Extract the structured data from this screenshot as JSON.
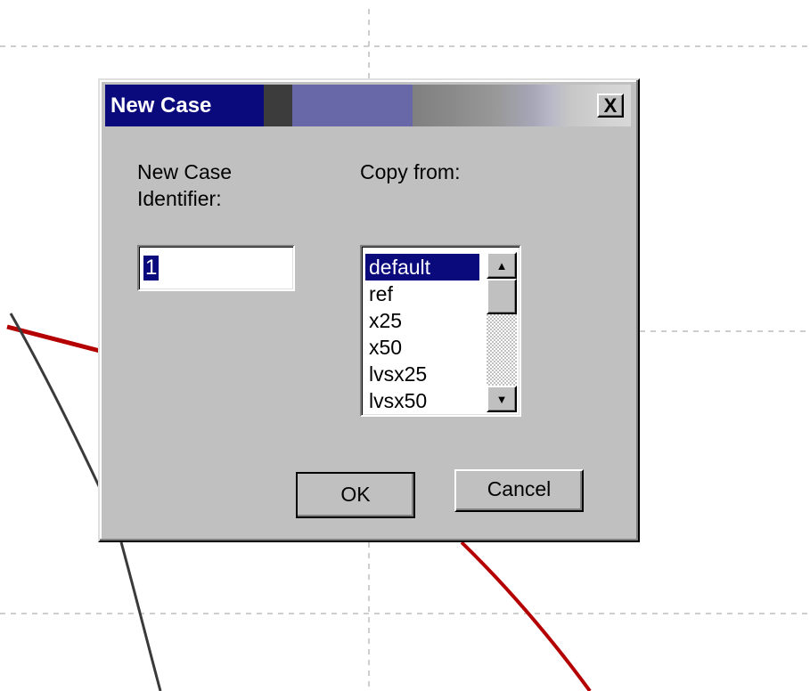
{
  "dialog": {
    "title": "New Case",
    "close_label": "X",
    "identifier_label_line1": "New Case",
    "identifier_label_line2": "Identifier:",
    "identifier_value": "1",
    "copy_from_label": "Copy from:",
    "copy_from_options": [
      "default",
      "ref",
      "x25",
      "x50",
      "lvsx25",
      "lvsx50"
    ],
    "copy_from_selected": "default",
    "ok_label": "OK",
    "cancel_label": "Cancel"
  },
  "colors": {
    "title_bar_active": "#0a0a7c",
    "dialog_face": "#c0c0c0",
    "selection": "#0a0a7c",
    "curve_red": "#b40000",
    "curve_dark": "#3a3a3a",
    "grid_dashed": "#bdbdbd"
  }
}
